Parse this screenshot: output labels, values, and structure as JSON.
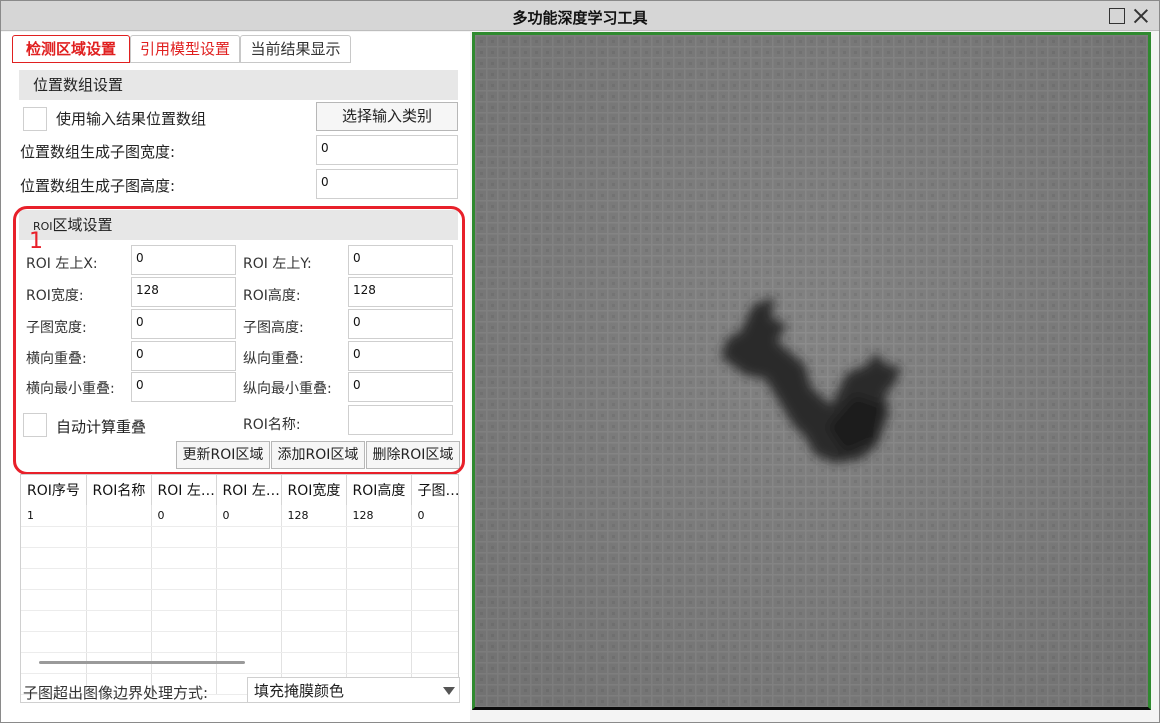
{
  "window": {
    "title": "多功能深度学习工具"
  },
  "tabs": [
    {
      "label": "检测区域设置",
      "active": true
    },
    {
      "label": "引用模型设置",
      "active": false
    },
    {
      "label": "当前结果显示",
      "active": false
    }
  ],
  "position_group": {
    "header": "位置数组设置",
    "use_input_checkbox_label": "使用输入结果位置数组",
    "select_category_button": "选择输入类别",
    "subimage_width_label": "位置数组生成子图宽度:",
    "subimage_width_value": "0",
    "subimage_height_label": "位置数组生成子图高度:",
    "subimage_height_value": "0"
  },
  "roi_group": {
    "header_prefix": "ROI",
    "header_suffix": "区域设置",
    "annotation_number": "1",
    "left_x_label": "ROI 左上X:",
    "left_x_value": "0",
    "left_y_label": "ROI 左上Y:",
    "left_y_value": "0",
    "width_label": "ROI宽度:",
    "width_value": "128",
    "height_label": "ROI高度:",
    "height_value": "128",
    "sub_width_label": "子图宽度:",
    "sub_width_value": "0",
    "sub_height_label": "子图高度:",
    "sub_height_value": "0",
    "h_overlap_label": "横向重叠:",
    "h_overlap_value": "0",
    "v_overlap_label": "纵向重叠:",
    "v_overlap_value": "0",
    "h_min_overlap_label": "横向最小重叠:",
    "h_min_overlap_value": "0",
    "v_min_overlap_label": "纵向最小重叠:",
    "v_min_overlap_value": "0",
    "auto_calc_label": "自动计算重叠",
    "roi_name_label": "ROI名称:",
    "roi_name_value": "",
    "update_button": "更新ROI区域",
    "add_button": "添加ROI区域",
    "delete_button": "删除ROI区域"
  },
  "roi_table": {
    "columns": [
      "ROI序号",
      "ROI名称",
      "ROI 左…",
      "ROI 左…",
      "ROI宽度",
      "ROI高度",
      "子图…"
    ],
    "rows": [
      [
        "1",
        "",
        "0",
        "0",
        "128",
        "128",
        "0"
      ]
    ]
  },
  "boundary": {
    "label": "子图超出图像边界处理方式:",
    "selected": "填充掩膜颜色"
  },
  "colors": {
    "accent_red": "#e8202a",
    "frame_green": "#2f8a2f",
    "image_gray": "#818181"
  }
}
